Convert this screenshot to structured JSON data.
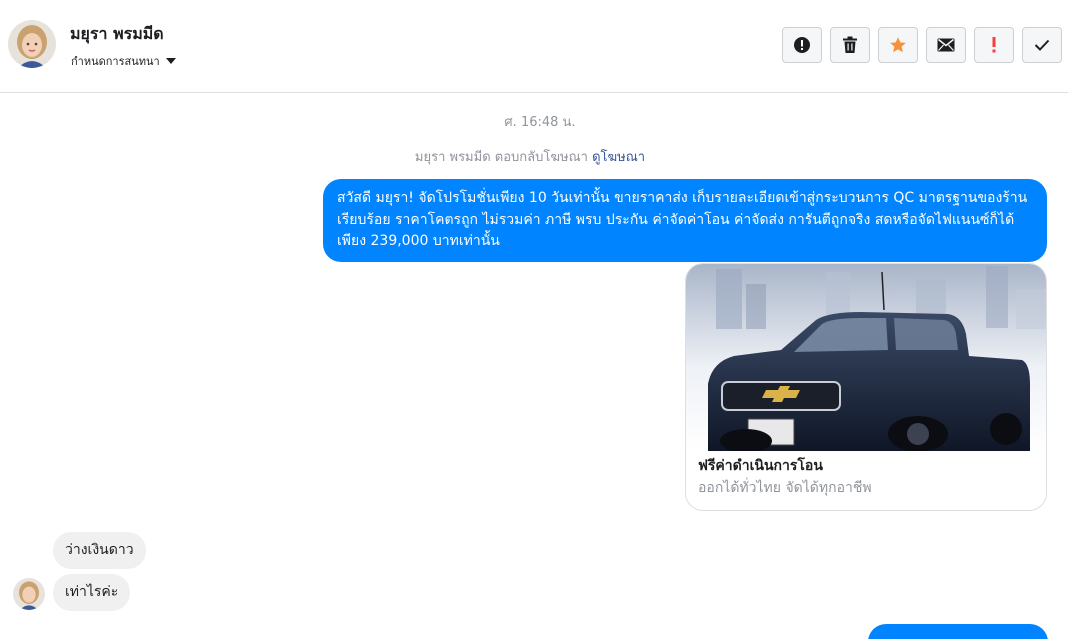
{
  "header": {
    "contact_name": "มยุรา พรมมีด",
    "assign_label": "กำหนดการสนทนา",
    "actions": [
      {
        "icon": "alert-circle-icon",
        "name": "mark-spam-button"
      },
      {
        "icon": "trash-icon",
        "name": "delete-button"
      },
      {
        "icon": "star-icon",
        "name": "star-button",
        "color": "#f7923b"
      },
      {
        "icon": "envelope-icon",
        "name": "mark-unread-button"
      },
      {
        "icon": "exclamation-icon",
        "name": "follow-up-button",
        "color": "#fa3e3e"
      },
      {
        "icon": "check-icon",
        "name": "mark-done-button"
      }
    ]
  },
  "conversation": {
    "timestamp": "ศ. 16:48 น.",
    "reply_note": "มยุรา พรมมีด ตอบกลับโฆษณา",
    "reply_link": "ดูโฆษณา",
    "outgoing_message": "สวัสดี มยุรา! จัดโปรโมชั่นเพียง 10 วันเท่านั้น ขายราคาส่ง เก็บรายละเอียดเข้าสู่กระบวนการ QC มาตรฐานของร้านเรียบร้อย ราคาโคตรถูก ไม่รวมค่า ภาษี พรบ ประกัน ค่าจัดค่าโอน ค่าจัดส่ง การันตีถูกจริง สดหรือจัดไฟแนนซ์ก็ได้  เพียง 239,000 บาทเท่านั้น",
    "ad_card": {
      "title": "ฟรีค่าดำเนินการโอน",
      "subtitle": "ออกได้ทั่วไทย จัดได้ทุกอาชีพ"
    },
    "incoming_messages": [
      "ว่างเงินดาว",
      "เท่าไรค่ะ"
    ]
  },
  "colors": {
    "brand_blue": "#0084ff",
    "incoming_bubble": "#f1f0f0",
    "link": "#365899"
  }
}
